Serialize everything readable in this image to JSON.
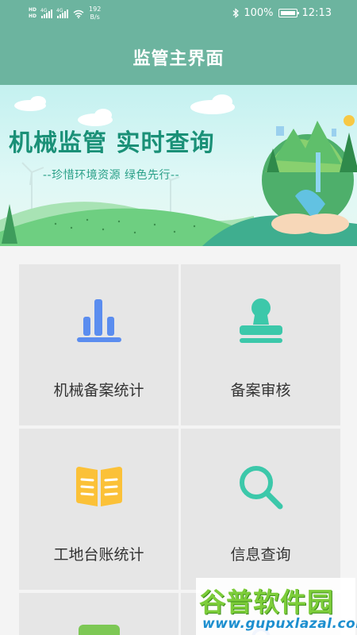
{
  "status_bar": {
    "hd_top": "HD",
    "hd_bottom": "HD",
    "net1": "4G",
    "net2": "4G",
    "speed_value": "192",
    "speed_unit": "B/s",
    "battery": "100%",
    "time": "12:13"
  },
  "header": {
    "title": "监管主界面"
  },
  "banner": {
    "headline": "机械监管  实时查询",
    "slogan": "--珍惜环境资源 绿色先行--"
  },
  "menu": {
    "items": [
      {
        "label": "机械备案统计",
        "icon": "bar-chart-icon",
        "color": "#5b8def"
      },
      {
        "label": "备案审核",
        "icon": "stamp-icon",
        "color": "#3cc8aa"
      },
      {
        "label": "工地台账统计",
        "icon": "ledger-book-icon",
        "color": "#fbc138"
      },
      {
        "label": "信息查询",
        "icon": "search-icon",
        "color": "#3cc8aa"
      },
      {
        "label": "",
        "icon": "green-tile-icon",
        "color": "#7dc855"
      },
      {
        "label": "",
        "icon": "blue-circle-icon",
        "color": "#4a7de0"
      }
    ]
  },
  "watermark": {
    "title": "谷普软件园",
    "url": "www.gupuxlazal.com"
  },
  "colors": {
    "primary": "#6cb49f",
    "tile_bg": "#e6e6e6",
    "headline": "#1a9077"
  }
}
